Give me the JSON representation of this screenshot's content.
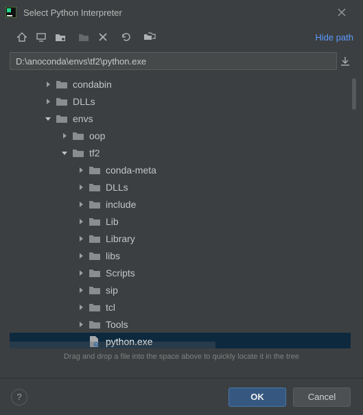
{
  "titlebar": {
    "title": "Select Python Interpreter"
  },
  "toolbar": {
    "hide_path": "Hide path"
  },
  "path": {
    "value": "D:\\anoconda\\envs\\tf2\\python.exe"
  },
  "tree": {
    "rows": [
      {
        "indent": 50,
        "chev": "right",
        "kind": "folder",
        "label": "condabin"
      },
      {
        "indent": 50,
        "chev": "right",
        "kind": "folder",
        "label": "DLLs"
      },
      {
        "indent": 50,
        "chev": "down",
        "kind": "folder",
        "label": "envs"
      },
      {
        "indent": 74,
        "chev": "right",
        "kind": "folder",
        "label": "oop"
      },
      {
        "indent": 74,
        "chev": "down",
        "kind": "folder",
        "label": "tf2"
      },
      {
        "indent": 98,
        "chev": "right",
        "kind": "folder",
        "label": "conda-meta"
      },
      {
        "indent": 98,
        "chev": "right",
        "kind": "folder",
        "label": "DLLs"
      },
      {
        "indent": 98,
        "chev": "right",
        "kind": "folder",
        "label": "include"
      },
      {
        "indent": 98,
        "chev": "right",
        "kind": "folder",
        "label": "Lib"
      },
      {
        "indent": 98,
        "chev": "right",
        "kind": "folder",
        "label": "Library"
      },
      {
        "indent": 98,
        "chev": "right",
        "kind": "folder",
        "label": "libs"
      },
      {
        "indent": 98,
        "chev": "right",
        "kind": "folder",
        "label": "Scripts"
      },
      {
        "indent": 98,
        "chev": "right",
        "kind": "folder",
        "label": "sip"
      },
      {
        "indent": 98,
        "chev": "right",
        "kind": "folder",
        "label": "tcl"
      },
      {
        "indent": 98,
        "chev": "right",
        "kind": "folder",
        "label": "Tools"
      },
      {
        "indent": 98,
        "chev": "none",
        "kind": "file",
        "label": "python.exe",
        "selected": true
      }
    ]
  },
  "hint": {
    "text": "Drag and drop a file into the space above to quickly locate it in the tree"
  },
  "footer": {
    "ok": "OK",
    "cancel": "Cancel",
    "help": "?"
  }
}
